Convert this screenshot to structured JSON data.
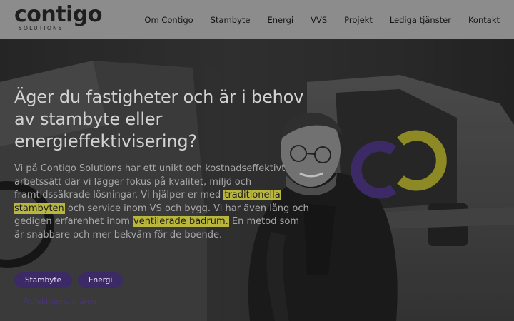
{
  "header": {
    "logo": {
      "word": "contigo",
      "sub": "SOLUTIONS"
    },
    "nav": [
      "Om Contigo",
      "Stambyte",
      "Energi",
      "VVS",
      "Projekt",
      "Lediga tjänster",
      "Kontakt"
    ]
  },
  "hero": {
    "headline": "Äger du fastigheter och är i behov av stambyte eller energieffektivisering?",
    "intro": {
      "p1": "Vi på Contigo Solutions har ett unikt och kostnadseffektivt arbetssätt där vi lägger fokus på kvalitet, miljö och framtidssäkrade lösningar. Vi hjälper er med ",
      "hl1": "traditionella stambyten",
      "p2": " och service inom VS och bygg. Vi har även lång och gedigen erfarenhet inom ",
      "hl2": "ventilerade badrum.",
      "p3": " En metod som är snabbare och mer bekväm för de boende."
    },
    "tags": [
      "Stambyte",
      "Energi"
    ],
    "projects_link": "Projekt genom åren"
  },
  "colors": {
    "header_bg": "#8c8c8c",
    "highlight": "#b8b63d",
    "accent_purple": "#3c2a66",
    "accent_olive": "#8d8a26"
  }
}
